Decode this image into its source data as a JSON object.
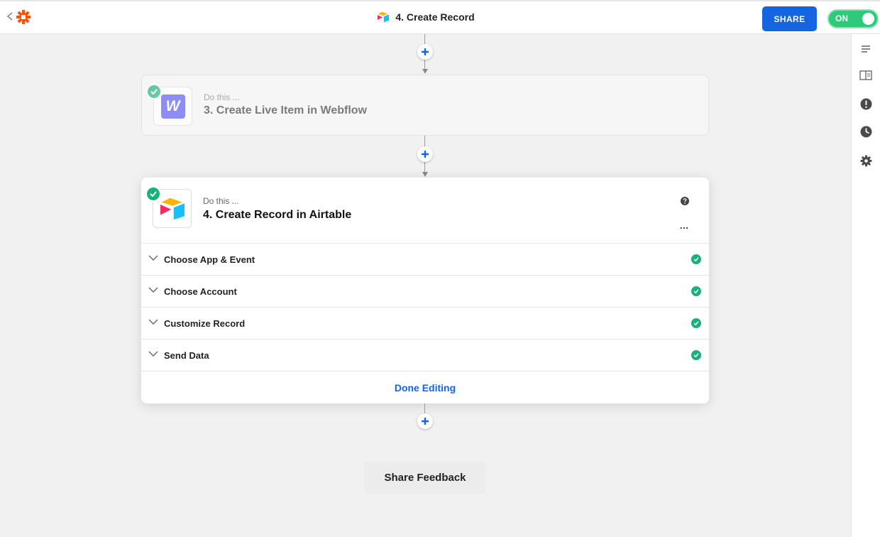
{
  "topbar": {
    "title": "4. Create Record",
    "share_label": "SHARE",
    "toggle_label": "ON"
  },
  "steps": [
    {
      "prefix": "Do this ...",
      "title": "3. Create Live Item in Webflow",
      "app": "Webflow",
      "app_letter": "W",
      "app_color": "#6b6cf5"
    },
    {
      "prefix": "Do this ...",
      "title": "4. Create Record in Airtable",
      "app": "Airtable"
    }
  ],
  "sections": [
    {
      "label": "Choose App & Event",
      "status": "complete"
    },
    {
      "label": "Choose Account",
      "status": "complete"
    },
    {
      "label": "Customize Record",
      "status": "complete"
    },
    {
      "label": "Send Data",
      "status": "complete"
    }
  ],
  "more_label": "...",
  "done_label": "Done Editing",
  "feedback_label": "Share Feedback",
  "rail": [
    "details-icon",
    "guide-icon",
    "alert-icon",
    "history-icon",
    "settings-icon"
  ],
  "colors": {
    "accent": "#1564e0",
    "zapier": "#ff4f00",
    "success": "#1ab07b",
    "toggle_on": "#2dca79"
  }
}
